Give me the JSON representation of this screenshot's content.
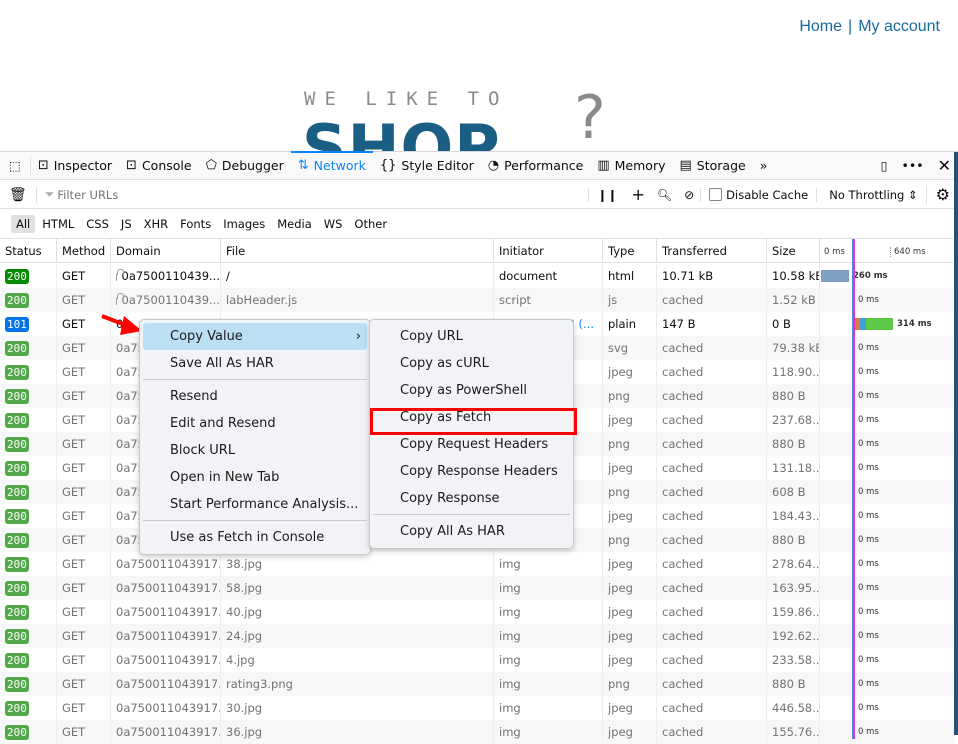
{
  "site": {
    "nav": [
      "Home",
      "My account"
    ],
    "nav_sep": "|",
    "logo_top": "WE LIKE TO",
    "logo_main": "SHOP",
    "logo_mark": "?"
  },
  "devtools": {
    "tabs": [
      {
        "label": "Inspector",
        "icon": "inspector-icon"
      },
      {
        "label": "Console",
        "icon": "console-icon"
      },
      {
        "label": "Debugger",
        "icon": "debugger-icon"
      },
      {
        "label": "Network",
        "icon": "network-icon",
        "selected": true
      },
      {
        "label": "Style Editor",
        "icon": "braces-icon"
      },
      {
        "label": "Performance",
        "icon": "gauge-icon"
      },
      {
        "label": "Memory",
        "icon": "chip-icon"
      },
      {
        "label": "Storage",
        "icon": "storage-icon"
      }
    ],
    "filter_placeholder": "Filter URLs",
    "disable_cache": "Disable Cache",
    "throttling": "No Throttling",
    "types": [
      "All",
      "HTML",
      "CSS",
      "JS",
      "XHR",
      "Fonts",
      "Images",
      "Media",
      "WS",
      "Other"
    ],
    "columns": [
      "Status",
      "Method",
      "Domain",
      "File",
      "Initiator",
      "Type",
      "Transferred",
      "Size"
    ],
    "waterfall_ticks": [
      "0 ms",
      "640 ms"
    ],
    "rows": [
      {
        "status": "200",
        "method": "GET",
        "domain": "0a7500110439...",
        "secure": true,
        "file": "/",
        "initiator": "document",
        "type": "html",
        "transferred": "10.71 kB",
        "size": "10.58 kB",
        "time": "260 ms"
      },
      {
        "status": "200",
        "method": "GET",
        "domain": "0a7500110439...",
        "secure": true,
        "file": "labHeader.js",
        "initiator": "script",
        "type": "js",
        "transferred": "cached",
        "size": "1.52 kB",
        "time": "0 ms"
      },
      {
        "status": "101",
        "method": "GET",
        "domain": "0a",
        "file": "",
        "initiator": "2 (...",
        "type": "plain",
        "transferred": "147 B",
        "size": "0 B",
        "time": "314 ms"
      },
      {
        "status": "200",
        "method": "GET",
        "domain": "0a75",
        "file": "",
        "initiator": "",
        "type": "svg",
        "transferred": "cached",
        "size": "79.38 kB",
        "time": "0 ms"
      },
      {
        "status": "200",
        "method": "GET",
        "domain": "0a75",
        "file": "",
        "initiator": "",
        "type": "jpeg",
        "transferred": "cached",
        "size": "118.90...",
        "time": "0 ms"
      },
      {
        "status": "200",
        "method": "GET",
        "domain": "0a75",
        "file": "",
        "initiator": "",
        "type": "png",
        "transferred": "cached",
        "size": "880 B",
        "time": "0 ms"
      },
      {
        "status": "200",
        "method": "GET",
        "domain": "0a75",
        "file": "",
        "initiator": "",
        "type": "jpeg",
        "transferred": "cached",
        "size": "237.68...",
        "time": "0 ms"
      },
      {
        "status": "200",
        "method": "GET",
        "domain": "0a75",
        "file": "",
        "initiator": "",
        "type": "png",
        "transferred": "cached",
        "size": "880 B",
        "time": "0 ms"
      },
      {
        "status": "200",
        "method": "GET",
        "domain": "0a75",
        "file": "",
        "initiator": "",
        "type": "jpeg",
        "transferred": "cached",
        "size": "131.18...",
        "time": "0 ms"
      },
      {
        "status": "200",
        "method": "GET",
        "domain": "0a75",
        "file": "",
        "initiator": "",
        "type": "png",
        "transferred": "cached",
        "size": "608 B",
        "time": "0 ms"
      },
      {
        "status": "200",
        "method": "GET",
        "domain": "0a75",
        "file": "",
        "initiator": "",
        "type": "jpeg",
        "transferred": "cached",
        "size": "184.43...",
        "time": "0 ms"
      },
      {
        "status": "200",
        "method": "GET",
        "domain": "0a75",
        "file": "",
        "initiator": "",
        "type": "png",
        "transferred": "cached",
        "size": "880 B",
        "time": "0 ms"
      },
      {
        "status": "200",
        "method": "GET",
        "domain": "0a750011043917...",
        "file": "38.jpg",
        "initiator": "img",
        "type": "jpeg",
        "transferred": "cached",
        "size": "278.64...",
        "time": "0 ms"
      },
      {
        "status": "200",
        "method": "GET",
        "domain": "0a750011043917...",
        "file": "58.jpg",
        "initiator": "img",
        "type": "jpeg",
        "transferred": "cached",
        "size": "163.95...",
        "time": "0 ms"
      },
      {
        "status": "200",
        "method": "GET",
        "domain": "0a750011043917...",
        "file": "40.jpg",
        "initiator": "img",
        "type": "jpeg",
        "transferred": "cached",
        "size": "159.86...",
        "time": "0 ms"
      },
      {
        "status": "200",
        "method": "GET",
        "domain": "0a750011043917...",
        "file": "24.jpg",
        "initiator": "img",
        "type": "jpeg",
        "transferred": "cached",
        "size": "192.62...",
        "time": "0 ms"
      },
      {
        "status": "200",
        "method": "GET",
        "domain": "0a750011043917...",
        "file": "4.jpg",
        "initiator": "img",
        "type": "jpeg",
        "transferred": "cached",
        "size": "233.58...",
        "time": "0 ms"
      },
      {
        "status": "200",
        "method": "GET",
        "domain": "0a750011043917...",
        "file": "rating3.png",
        "initiator": "img",
        "type": "png",
        "transferred": "cached",
        "size": "880 B",
        "time": "0 ms"
      },
      {
        "status": "200",
        "method": "GET",
        "domain": "0a750011043917...",
        "file": "30.jpg",
        "initiator": "img",
        "type": "jpeg",
        "transferred": "cached",
        "size": "446.58...",
        "time": "0 ms"
      },
      {
        "status": "200",
        "method": "GET",
        "domain": "0a750011043917...",
        "file": "36.jpg",
        "initiator": "img",
        "type": "jpeg",
        "transferred": "cached",
        "size": "155.76...",
        "time": "0 ms"
      }
    ]
  },
  "context_menu": {
    "items": [
      "Copy Value",
      "Save All As HAR",
      "-",
      "Resend",
      "Edit and Resend",
      "Block URL",
      "Open in New Tab",
      "Start Performance Analysis...",
      "-",
      "Use as Fetch in Console"
    ],
    "highlighted": "Copy Value"
  },
  "submenu": {
    "items": [
      "Copy URL",
      "Copy as cURL",
      "Copy as PowerShell",
      "Copy as Fetch",
      "Copy Request Headers",
      "Copy Response Headers",
      "Copy Response",
      "-",
      "Copy All As HAR"
    ],
    "annotated": "Copy as Fetch"
  },
  "colors": {
    "accent": "#0a84ff",
    "annotation": "#ff0000",
    "status_ok": "#52a74b",
    "status_switch": "#0074e8"
  }
}
